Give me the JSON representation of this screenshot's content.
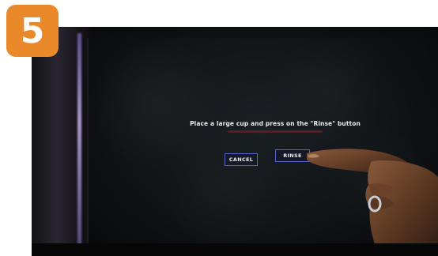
{
  "step_badge": {
    "number": "5",
    "color": "#e9892a"
  },
  "screen": {
    "prompt": "Place a large cup and press on the \"Rinse\" button",
    "buttons": {
      "cancel_label": "CANCEL",
      "rinse_label": "RINSE"
    },
    "accent_color": "#5262c8"
  }
}
